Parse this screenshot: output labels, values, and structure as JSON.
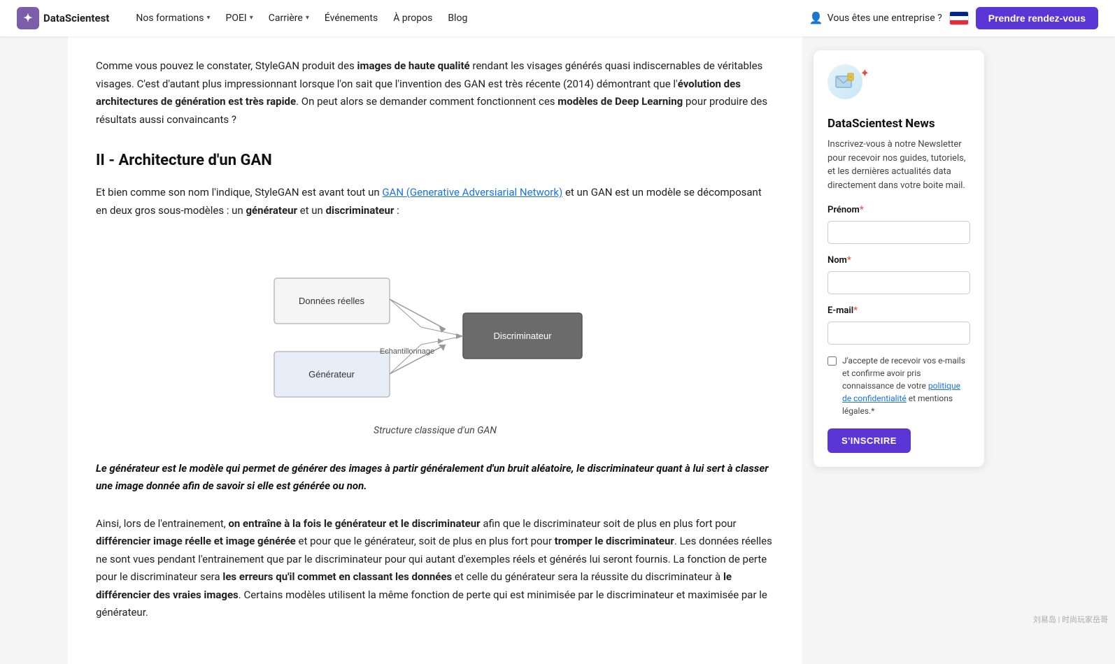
{
  "navbar": {
    "logo_text": "DataScientest",
    "links": [
      {
        "label": "Nos formations",
        "has_dropdown": true
      },
      {
        "label": "POEI",
        "has_dropdown": true
      },
      {
        "label": "Carrière",
        "has_dropdown": true
      },
      {
        "label": "Événements",
        "has_dropdown": false
      },
      {
        "label": "À propos",
        "has_dropdown": false
      },
      {
        "label": "Blog",
        "has_dropdown": false
      }
    ],
    "enterprise_label": "Vous êtes une entreprise ?",
    "cta_label": "Prendre rendez-vous"
  },
  "main": {
    "intro": "Comme vous pouvez le constater, StyleGAN produit des ",
    "intro_bold1": "images de haute qualité",
    "intro_mid": " rendant les visages générés quasi indiscernables de véritables visages. C'est d'autant plus impressionnant lorsque l'on sait que l'invention des GAN est très récente (2014) démontrant que l'",
    "intro_bold2": "évolution des architectures de génération est très rapide",
    "intro_end": ". On peut alors se demander comment fonctionnent ces ",
    "intro_bold3": "modèles de Deep Learning",
    "intro_final": " pour produire des résultats aussi convaincants ?",
    "section_title": "II - Architecture d'un GAN",
    "section_p1_pre": "Et bien comme son nom l'indique, StyleGAN est avant tout un ",
    "section_p1_link": "GAN (Generative Adversiarial Network)",
    "section_p1_post": " et un GAN est un modèle se décomposant en deux gros sous-modèles : un ",
    "section_p1_bold1": "générateur",
    "section_p1_mid": " et un ",
    "section_p1_bold2": "discriminateur",
    "section_p1_end": " :",
    "diagram": {
      "caption": "Structure classique d'un GAN",
      "node_donnees": "Données réelles",
      "node_echantillonnage": "Echantillonnage",
      "node_discriminateur": "Discriminateur",
      "node_generateur": "Générateur"
    },
    "quote": "Le générateur est le modèle qui permet de générer des images à partir généralement d'un bruit aléatoire, le discriminateur quant à lui sert à classer une image donnée afin de savoir si elle est générée ou non.",
    "bottom_pre": "Ainsi, lors de l'entrainement, ",
    "bottom_bold1": "on entraîne à la fois le générateur et le discriminateur",
    "bottom_mid1": " afin que le discriminateur soit de plus en plus fort pour ",
    "bottom_bold2": "différencier image réelle et image générée",
    "bottom_mid2": " et pour que le générateur, soit de plus en plus fort pour ",
    "bottom_bold3": "tromper le discriminateur",
    "bottom_mid3": ". Les données réelles ne sont vues pendant l'entrainement que par le discriminateur pour qui autant d'exemples réels et générés lui seront fournis. La fonction de perte pour le discriminateur sera ",
    "bottom_bold4": "les erreurs qu'il commet en classant les données",
    "bottom_mid4": " et celle du générateur sera la réussite du discriminateur à ",
    "bottom_bold5": "le différencier des vraies images",
    "bottom_end": ". Certains modèles utilisent la même fonction de perte qui est minimisée par le discriminateur et maximisée par le générateur."
  },
  "sidebar": {
    "title": "DataScientest News",
    "description": "Inscrivez-vous à notre Newsletter pour recevoir nos guides, tutoriels, et les dernières actualités data directement dans votre boite mail.",
    "form": {
      "prenom_label": "Prénom",
      "prenom_required": "*",
      "nom_label": "Nom",
      "nom_required": "*",
      "email_label": "E-mail",
      "email_required": "*",
      "checkbox_text": "J'accepte de recevoir vos e-mails et confirme avoir pris connaissance de votre politique de confidentialité et mentions légales.",
      "checkbox_required": "*",
      "submit_label": "S'INSCRIRE"
    }
  },
  "watermark": "刘易岛 | 时尚玩家岳哥"
}
